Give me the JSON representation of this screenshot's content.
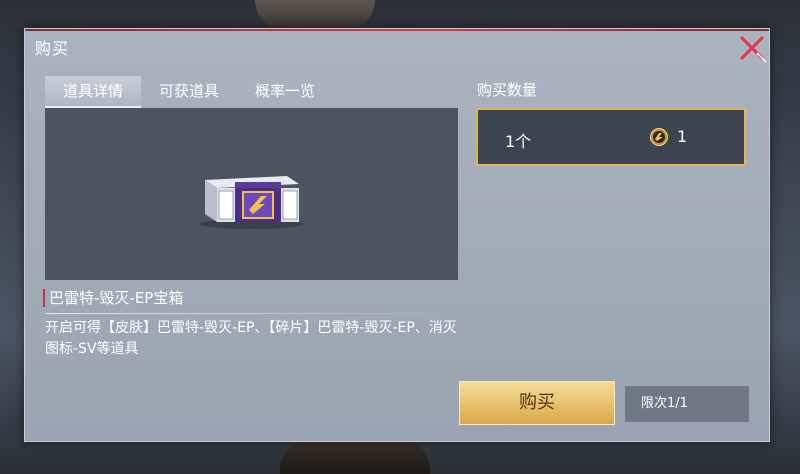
{
  "dialog": {
    "title": "购买"
  },
  "tabs": [
    {
      "label": "道具详情",
      "active": true
    },
    {
      "label": "可获道具",
      "active": false
    },
    {
      "label": "概率一览",
      "active": false
    }
  ],
  "item": {
    "name": "巴雷特-毁灭-EP宝箱",
    "description": "开启可得【皮肤】巴雷特-毁灭-EP、【碎片】巴雷特-毁灭-EP、消灭图标-SV等道具"
  },
  "purchase": {
    "quantity_label": "购买数量",
    "quantity": "1个",
    "price": "1",
    "currency_icon": "cf-coin-icon",
    "buy_label": "购买",
    "limit": "限次1/1"
  },
  "colors": {
    "accent_gold": "#e0b45a",
    "close_red": "#e23a44",
    "title_line": "#d63a44"
  }
}
